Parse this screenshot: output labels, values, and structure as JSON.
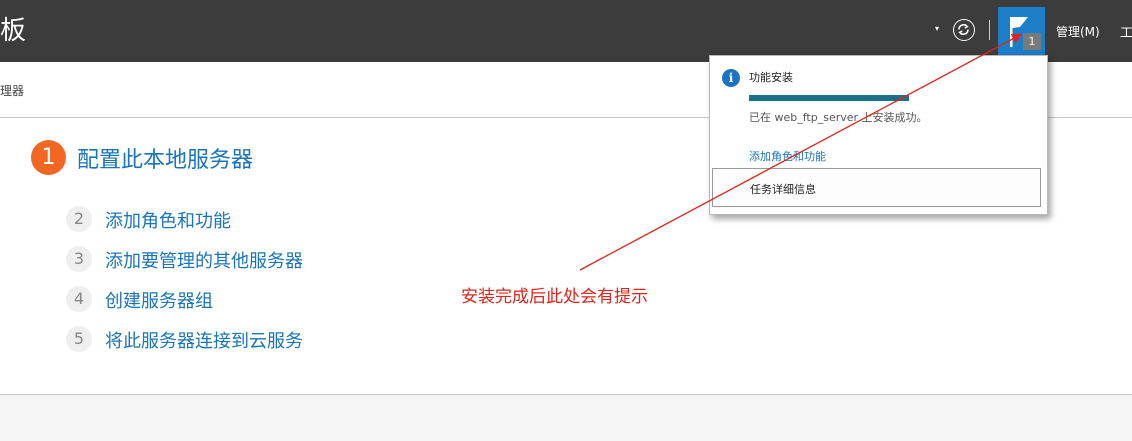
{
  "header": {
    "title": "板",
    "dropdown_glyph": "▾",
    "refresh_icon": "refresh-icon",
    "separator": "|",
    "notification_count": "1",
    "menu_manage": "管理(M)",
    "menu_tools": "工"
  },
  "subheader": {
    "breadcrumb": "理器"
  },
  "quick_start": {
    "step1_number": "1",
    "step1_title": "配置此本地服务器",
    "items": [
      {
        "number": "2",
        "label": "添加角色和功能"
      },
      {
        "number": "3",
        "label": "添加要管理的其他服务器"
      },
      {
        "number": "4",
        "label": "创建服务器组"
      },
      {
        "number": "5",
        "label": "将此服务器连接到云服务"
      }
    ]
  },
  "notification": {
    "title": "功能安装",
    "progress_fraction": 1.0,
    "message": "已在 web_ftp_server 上安装成功。",
    "link": "添加角色和功能",
    "task_details": "任务详细信息"
  },
  "annotation": {
    "text": "安装完成后此处会有提示",
    "color": "#e0231b"
  },
  "colors": {
    "accent": "#1a74b9",
    "step": "#f26822",
    "flag": "#1d7ec8",
    "progress": "#1c6f86"
  }
}
